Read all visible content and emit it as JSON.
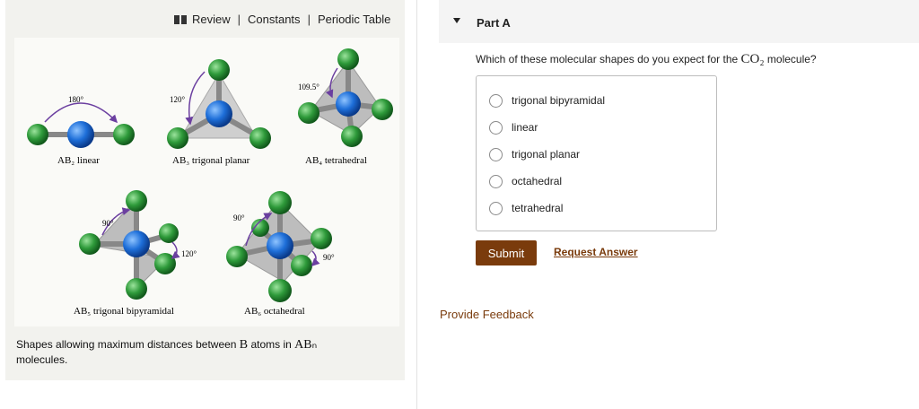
{
  "toolbar": {
    "review": "Review",
    "sep1": "|",
    "constants": "Constants",
    "sep2": "|",
    "periodic_table": "Periodic Table"
  },
  "figure": {
    "angle_180": "180°",
    "angle_120_planar": "120°",
    "angle_109": "109.5°",
    "angle_90_tbp": "90°",
    "angle_120_tbp": "120°",
    "angle_90_oct_a": "90°",
    "angle_90_oct_b": "90°",
    "label_linear": "AB₂ linear",
    "label_planar": "AB₃ trigonal planar",
    "label_tetrahedral": "AB₄ tetrahedral",
    "label_tbp": "AB₅ trigonal bipyramidal",
    "label_octahedral": "AB₆ octahedral",
    "colors": {
      "central": "#1e6fd9",
      "outer": "#2e9a3a",
      "bond": "#777777",
      "arrow": "#6b3fa0"
    }
  },
  "caption": {
    "before": "Shapes allowing maximum distances between ",
    "b": "B",
    "middle": " atoms in ",
    "abn": "ABₙ",
    "after": " molecules."
  },
  "part": {
    "title": "Part A"
  },
  "question": {
    "before": "Which of these molecular shapes do you expect for the ",
    "formula": "CO₂",
    "after": " molecule?"
  },
  "options": [
    {
      "label": "trigonal bipyramidal"
    },
    {
      "label": "linear"
    },
    {
      "label": "trigonal planar"
    },
    {
      "label": "octahedral"
    },
    {
      "label": "tetrahedral"
    }
  ],
  "buttons": {
    "submit": "Submit",
    "request_answer": "Request Answer"
  },
  "feedback": "Provide Feedback"
}
